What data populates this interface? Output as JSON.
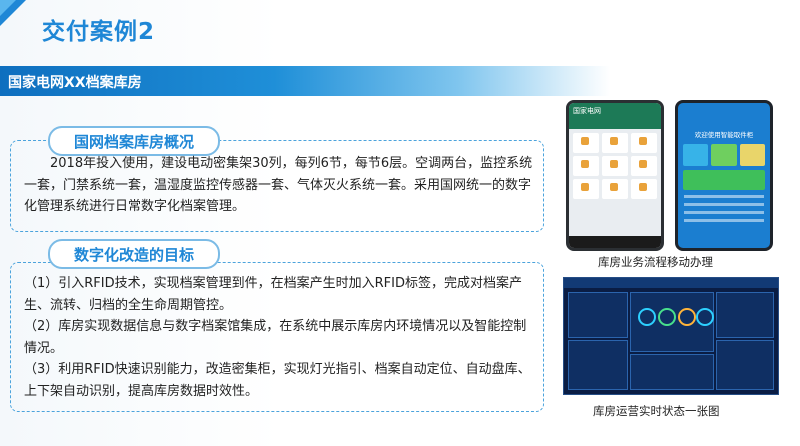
{
  "slide": {
    "title": "交付案例2",
    "section": "国家电网XX档案库房"
  },
  "box1": {
    "heading": "国网档案库房概况",
    "text": "2018年投入使用，建设电动密集架30列，每列6节，每节6层。空调两台，监控系统一套，门禁系统一套，温湿度监控传感器一套、气体灭火系统一套。采用国网统一的数字化管理系统进行日常数字化档案管理。"
  },
  "box2": {
    "heading": "数字化改造的目标",
    "lines": [
      "（1）引入RFID技术，实现档案管理到件，在档案产生时加入RFID标签，完成对档案产生、流转、归档的全生命周期管控。",
      "（2）库房实现数据信息与数字档案馆集成，在系统中展示库房内环境情况以及智能控制情况。",
      "（3）利用RFID快速识别能力，改造密集柜，实现灯光指引、档案自动定位、自动盘库、上下架自动识别，提高库房数据时效性。"
    ]
  },
  "figures": {
    "caption_mobile": "库房业务流程移动办理",
    "caption_dashboard": "库房运营实时状态一张图",
    "phone1_title": "国家电网",
    "phone2_title": "欢迎使用智能取件柜"
  },
  "colors": {
    "accent": "#1f87d6",
    "bar_dark": "#0e6fbf",
    "panel_border": "#4ba3dc"
  }
}
